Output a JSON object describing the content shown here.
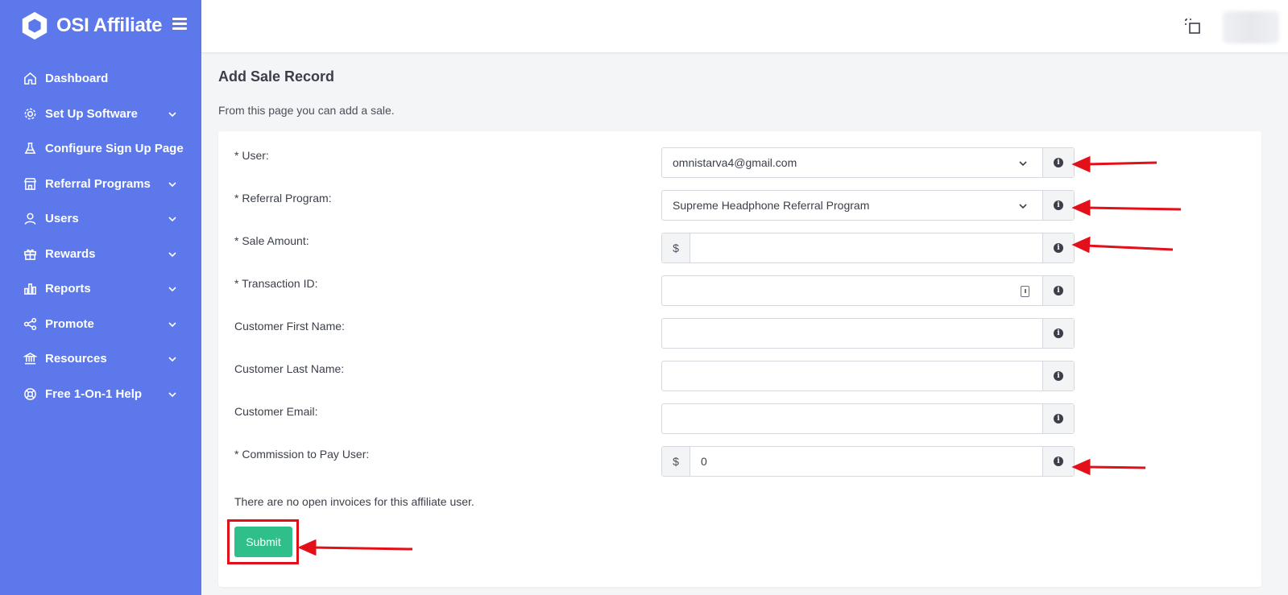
{
  "app": {
    "name": "OSI Affiliate"
  },
  "sidebar": {
    "items": [
      {
        "label": "Dashboard",
        "icon": "home-icon",
        "expandable": false
      },
      {
        "label": "Set Up Software",
        "icon": "gear-icon",
        "expandable": true
      },
      {
        "label": "Configure Sign Up Page",
        "icon": "flask-icon",
        "expandable": false
      },
      {
        "label": "Referral Programs",
        "icon": "store-icon",
        "expandable": true
      },
      {
        "label": "Users",
        "icon": "user-icon",
        "expandable": true
      },
      {
        "label": "Rewards",
        "icon": "gift-icon",
        "expandable": true
      },
      {
        "label": "Reports",
        "icon": "bar-chart-icon",
        "expandable": true
      },
      {
        "label": "Promote",
        "icon": "share-icon",
        "expandable": true
      },
      {
        "label": "Resources",
        "icon": "bank-icon",
        "expandable": true
      },
      {
        "label": "Free 1-On-1 Help",
        "icon": "lifebuoy-icon",
        "expandable": true
      }
    ]
  },
  "page": {
    "title": "Add Sale Record",
    "subtitle": "From this page you can add a sale."
  },
  "form": {
    "user": {
      "label": "* User:",
      "value": "omnistarva4@gmail.com"
    },
    "referral_program": {
      "label": "* Referral Program:",
      "value": "Supreme Headphone Referral Program"
    },
    "sale_amount": {
      "label": "* Sale Amount:",
      "prefix": "$",
      "value": ""
    },
    "transaction_id": {
      "label": "* Transaction ID:",
      "value": ""
    },
    "first_name": {
      "label": "Customer First Name:",
      "value": ""
    },
    "last_name": {
      "label": "Customer Last Name:",
      "value": ""
    },
    "email": {
      "label": "Customer Email:",
      "value": ""
    },
    "commission": {
      "label": "* Commission to Pay User:",
      "prefix": "$",
      "value": "0"
    },
    "note": "There are no open invoices for this affiliate user.",
    "submit_label": "Submit",
    "info_glyph": "i"
  },
  "colors": {
    "sidebar": "#5c78eb",
    "submit": "#2fbf8a",
    "annotation": "#e3101a"
  }
}
